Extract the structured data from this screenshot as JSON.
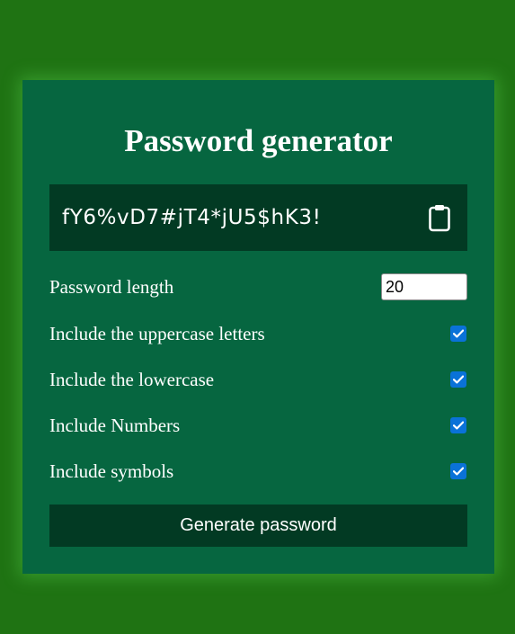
{
  "title": "Password generator",
  "result": {
    "password": "fY6%vD7#jT4*jU5$hK3!",
    "clipboard_icon": "clipboard-icon"
  },
  "settings": {
    "length": {
      "label": "Password length",
      "value": "20"
    },
    "uppercase": {
      "label": "Include the uppercase letters",
      "checked": true
    },
    "lowercase": {
      "label": "Include the lowercase",
      "checked": true
    },
    "numbers": {
      "label": "Include Numbers",
      "checked": true
    },
    "symbols": {
      "label": "Include symbols",
      "checked": true
    }
  },
  "generate_label": "Generate password",
  "colors": {
    "page_background": "#1f7313",
    "card_background": "#066640",
    "dark_panel": "#023a23",
    "checkbox_accent": "#0a72d8"
  }
}
